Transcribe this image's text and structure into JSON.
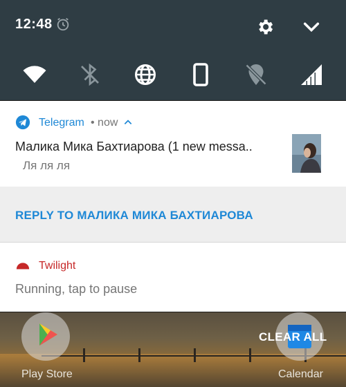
{
  "status_bar": {
    "time": "12:48",
    "alarm_icon": "alarm-icon"
  },
  "quick_settings": {
    "tiles": [
      "wifi-icon",
      "bluetooth-off-icon",
      "globe-icon",
      "phone-rotation-icon",
      "location-off-icon",
      "signal-icon"
    ],
    "settings_icon": "gear-icon",
    "collapse_icon": "chevron-down-icon",
    "background_color": "#2f3d44"
  },
  "notifications": [
    {
      "app_name": "Telegram",
      "time": "• now",
      "title": "Малика Мика Бахтиарова (1 new messa..",
      "text": "Ля ля ля",
      "accent_color": "#1e88d6",
      "action_label": "REPLY TO МАЛИКА МИКА БАХТИАРОВА"
    },
    {
      "app_name": "Twilight",
      "text": "Running, tap to pause",
      "accent_color": "#c62828"
    }
  ],
  "home_screen": {
    "clear_all_label": "CLEAR ALL",
    "apps": [
      "Play Store",
      "Calendar"
    ]
  }
}
